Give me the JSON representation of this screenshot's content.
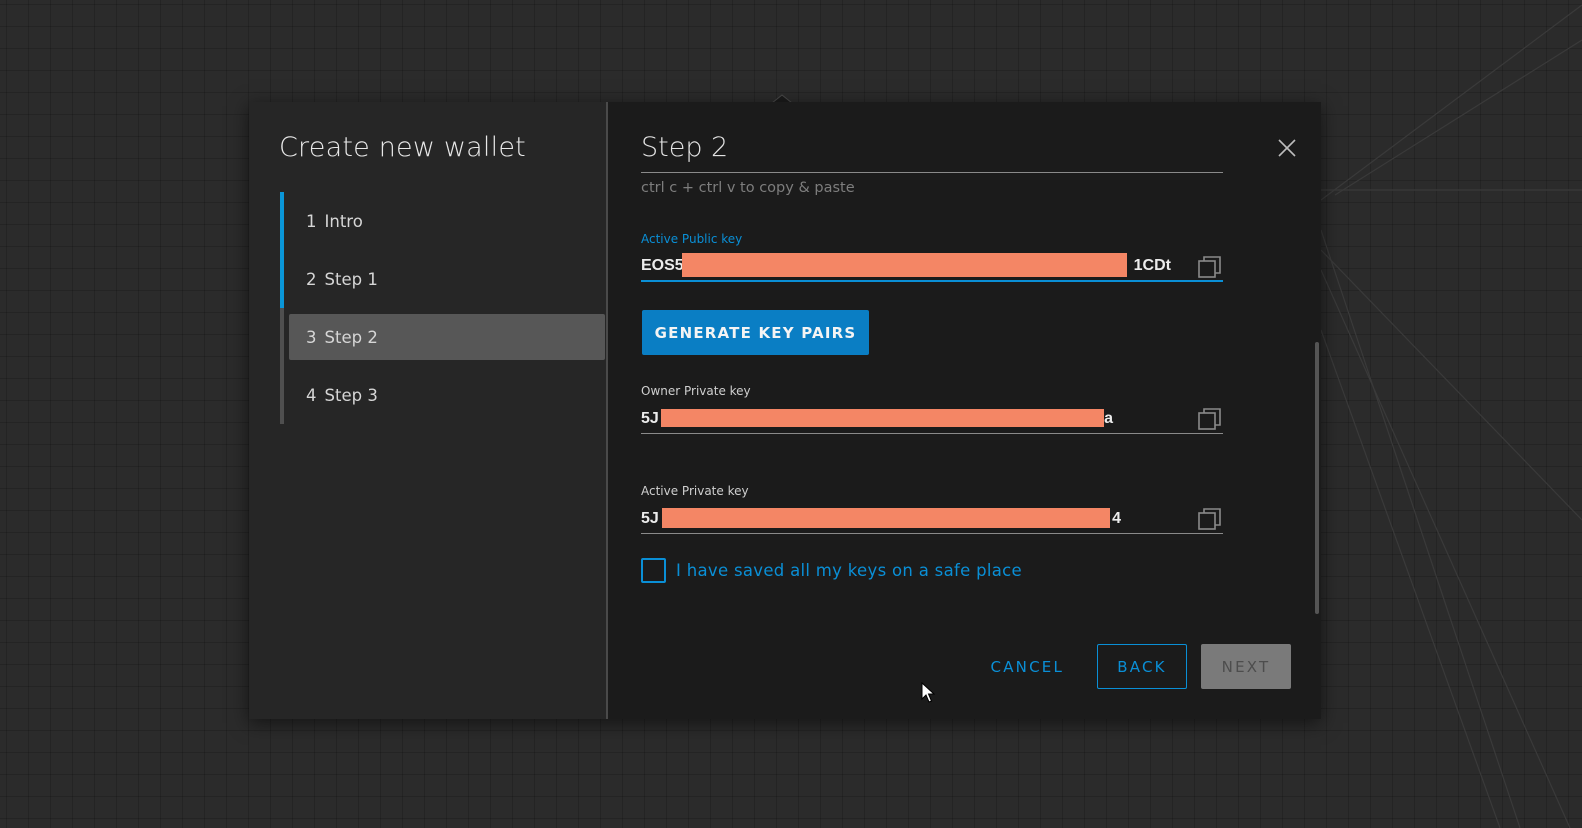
{
  "wizard": {
    "title": "Create new wallet",
    "steps": [
      {
        "num": "1",
        "label": "Intro"
      },
      {
        "num": "2",
        "label": "Step 1"
      },
      {
        "num": "3",
        "label": "Step 2"
      },
      {
        "num": "4",
        "label": "Step 3"
      }
    ],
    "active_step": "3"
  },
  "panel": {
    "title": "Step 2",
    "hint": "ctrl c + ctrl v to copy & paste",
    "active_public_key": {
      "label": "Active Public key",
      "value_prefix": "EOS5",
      "value_suffix": "1CDt"
    },
    "generate_label": "GENERATE KEY PAIRS",
    "owner_private_key": {
      "label": "Owner Private key",
      "value_prefix": "5J",
      "value_suffix": "a"
    },
    "active_private_key": {
      "label": "Active Private key",
      "value_prefix": "5J",
      "value_suffix": "4"
    },
    "saved_checkbox_label": "I have saved all my keys on a safe place"
  },
  "actions": {
    "cancel": "CANCEL",
    "back": "BACK",
    "next": "NEXT"
  },
  "colors": {
    "accent": "#0a8fd6",
    "redaction": "#f48665",
    "panel_bg": "#1b1b1b",
    "sidebar_bg": "#262626"
  }
}
